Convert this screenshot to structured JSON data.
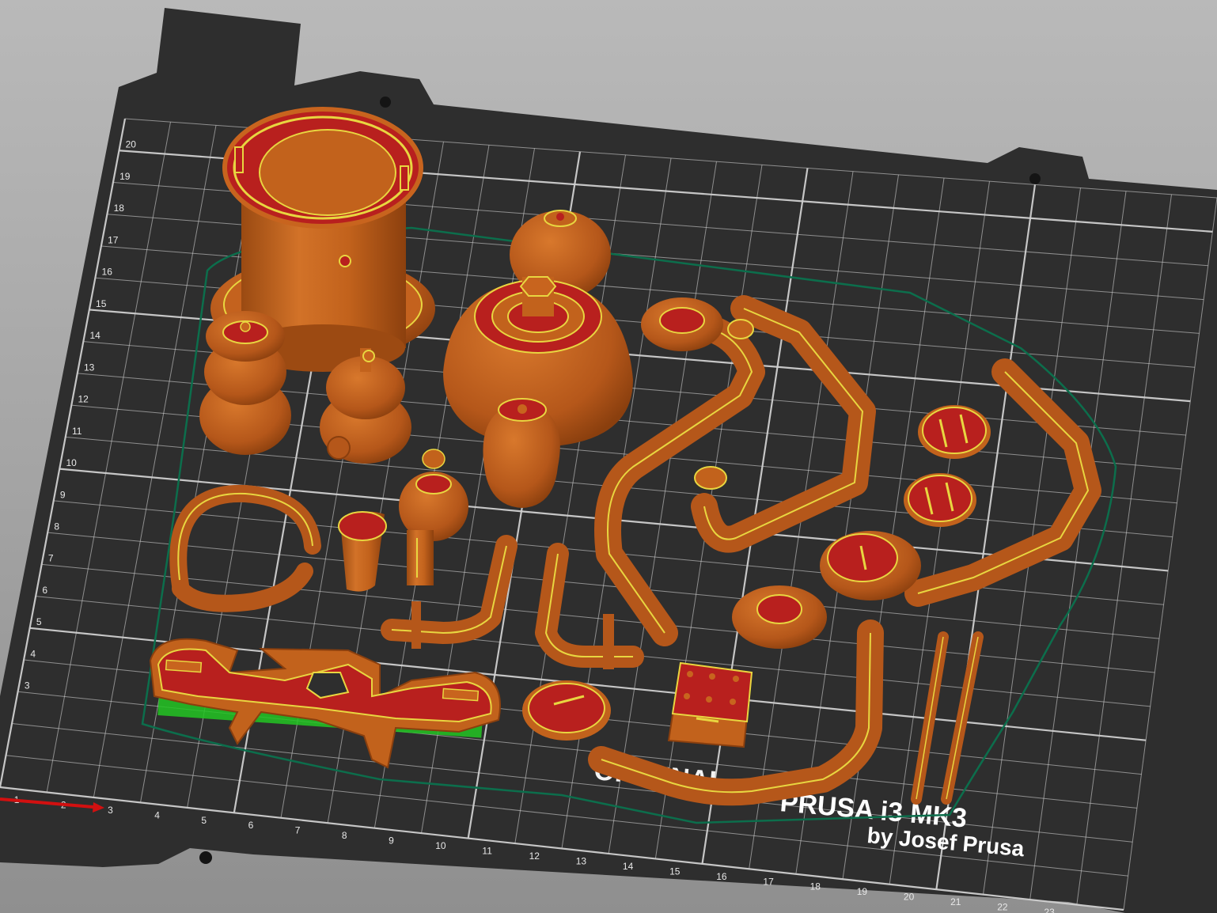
{
  "viewport": {
    "bed_label_line1": "PRUSA i3  MK3",
    "bed_label_line2": "by Josef Prusa",
    "bed_label_partial": "ORIGINAL"
  },
  "axes": {
    "x_ticks": [
      "1",
      "2",
      "3",
      "4",
      "5",
      "6",
      "7",
      "8",
      "9",
      "10",
      "11",
      "12",
      "13",
      "14",
      "15",
      "16",
      "17",
      "18",
      "19",
      "20",
      "21",
      "22",
      "23"
    ],
    "y_ticks": [
      "20",
      "19",
      "18",
      "17",
      "16",
      "15",
      "14",
      "13",
      "12",
      "11",
      "10",
      "9",
      "8",
      "7",
      "6",
      "5",
      "4",
      "3"
    ]
  },
  "colors": {
    "background": "#a8a8a8",
    "bed": "#2e2e2e",
    "grid": "#cfcfcf",
    "perimeter": "#c8641e",
    "infill": "#b8201e",
    "highlight": "#e8d640",
    "support": "#22c422",
    "skirt": "#0c6e4c",
    "x_axis": "#d21010"
  }
}
